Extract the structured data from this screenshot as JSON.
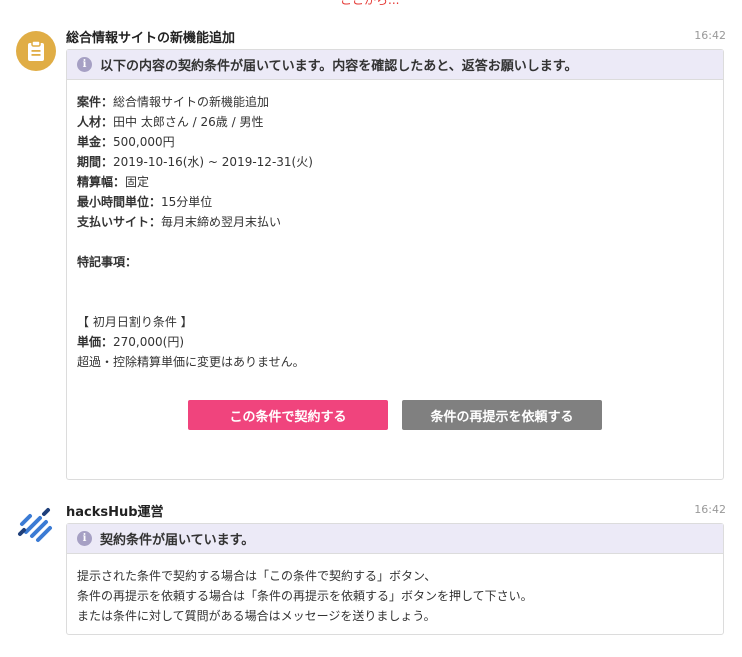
{
  "top_partial_text": "ここから...",
  "messages": [
    {
      "sender": "総合情報サイトの新機能追加",
      "time": "16:42",
      "header": "以下の内容の契約条件が届いています。内容を確認したあと、返答お願いします。",
      "details": {
        "case_label": "案件：",
        "case_value": "総合情報サイトの新機能追加",
        "person_label": "人材：",
        "person_value": "田中 太郎さん / 26歳 / 男性",
        "price_label": "単金：",
        "price_value": "500,000円",
        "period_label": "期間：",
        "period_value": "2019-10-16(水) ~ 2019-12-31(火)",
        "settlement_label": "精算幅：",
        "settlement_value": "固定",
        "min_unit_label": "最小時間単位：",
        "min_unit_value": "15分単位",
        "payment_label": "支払いサイト：",
        "payment_value": "毎月末締め翌月末払い",
        "notes_label": "特記事項：",
        "prorate_title": "【 初月日割り条件 】",
        "unit_price_label": "単価：",
        "unit_price_value": "270,000(円)",
        "overage_note": "超過・控除精算単価に変更はありません。"
      },
      "buttons": {
        "accept": "この条件で契約する",
        "repropose": "条件の再提示を依頼する"
      }
    },
    {
      "sender": "hacksHub運営",
      "time": "16:42",
      "header": "契約条件が届いています。",
      "lines": [
        "提示された条件で契約する場合は「この条件で契約する」ボタン、",
        "条件の再提示を依頼する場合は「条件の再提示を依頼する」ボタンを押して下さい。",
        "または条件に対して質問がある場合はメッセージを送りましょう。"
      ]
    }
  ],
  "colors": {
    "avatar_bg": "#e0ad45",
    "header_bg": "#eceaf7",
    "info_icon": "#a6a0c4",
    "accept_button": "#f0447d",
    "repropose_button": "#808080",
    "hub_logo": "#3b7bd4"
  },
  "icons": {
    "avatar_1": "clipboard-icon",
    "avatar_2": "hackshub-logo",
    "header": "info-icon"
  }
}
